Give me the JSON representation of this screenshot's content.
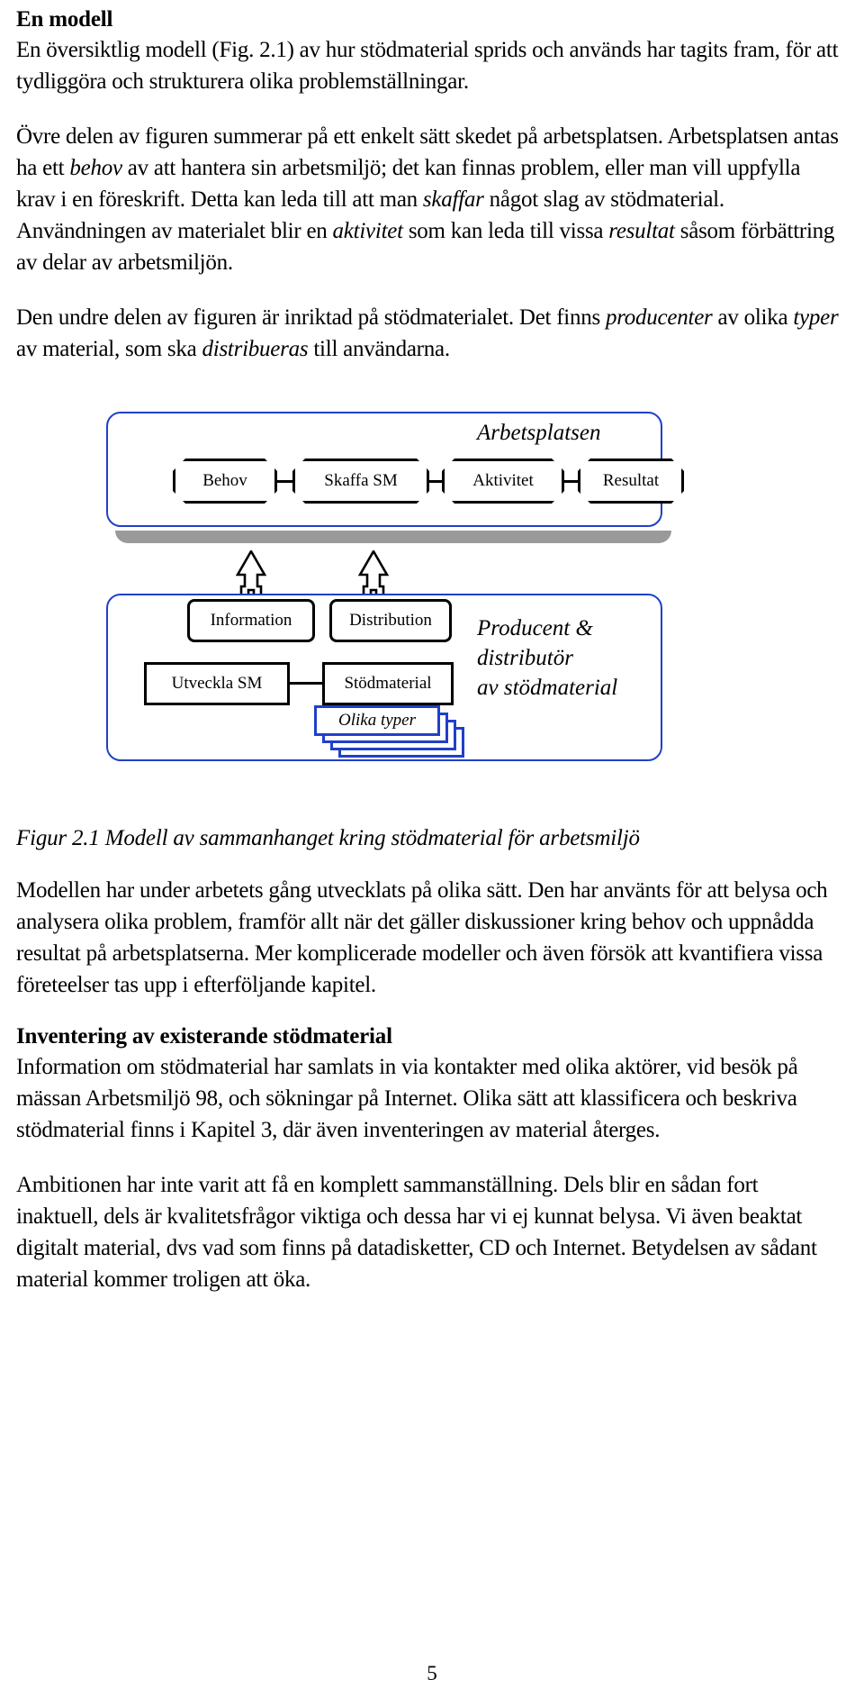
{
  "document": {
    "page_number": "5",
    "heading1": "En modell",
    "para1": {
      "runs": [
        {
          "t": "En översiktlig modell (Fig. 2.1) av hur stödmaterial sprids och används har tagits fram, för att tydliggöra och strukturera olika problemställningar.",
          "i": false
        }
      ]
    },
    "para2": {
      "runs": [
        {
          "t": "Övre delen av figuren summerar på ett enkelt sätt skedet på arbetsplatsen. Arbetsplatsen antas ha ett ",
          "i": false
        },
        {
          "t": "behov",
          "i": true
        },
        {
          "t": " av att hantera sin arbetsmiljö; det kan finnas problem, eller man vill uppfylla krav i en föreskrift. Detta kan leda till att man ",
          "i": false
        },
        {
          "t": "skaffar",
          "i": true
        },
        {
          "t": " något slag av stödmaterial. Användningen av materialet blir en ",
          "i": false
        },
        {
          "t": "aktivitet",
          "i": true
        },
        {
          "t": " som kan leda till vissa ",
          "i": false
        },
        {
          "t": "resultat",
          "i": true
        },
        {
          "t": " såsom förbättring av delar av arbetsmiljön.",
          "i": false
        }
      ]
    },
    "para3": {
      "runs": [
        {
          "t": "Den undre delen av figuren är inriktad på stödmaterialet. Det finns ",
          "i": false
        },
        {
          "t": "producenter",
          "i": true
        },
        {
          "t": " av olika ",
          "i": false
        },
        {
          "t": "typer",
          "i": true
        },
        {
          "t": " av material, som ska ",
          "i": false
        },
        {
          "t": "distribueras",
          "i": true
        },
        {
          "t": " till användarna.",
          "i": false
        }
      ]
    },
    "caption": "Figur 2.1  Modell av sammanhanget kring stödmaterial för arbetsmiljö",
    "para4": {
      "runs": [
        {
          "t": "Modellen har under arbetets gång utvecklats på olika sätt. Den har använts för att belysa och analysera olika problem, framför allt när det gäller diskussioner kring behov och uppnådda resultat på arbetsplatserna. Mer komplicerade modeller och även försök att kvantifiera vissa företeelser tas upp i efterföljande kapitel.",
          "i": false
        }
      ]
    },
    "heading2": "Inventering av existerande stödmaterial",
    "para5": {
      "runs": [
        {
          "t": "Information om stödmaterial har samlats in via kontakter med olika aktörer, vid besök på mässan Arbetsmiljö 98, och sökningar på Internet. Olika sätt att klassificera och beskriva stödmaterial finns i Kapitel 3, där även inventeringen av material återges.",
          "i": false
        }
      ]
    },
    "para6": {
      "runs": [
        {
          "t": "Ambitionen har inte varit att få en komplett sammanställning. Dels blir en sådan fort inaktuell, dels är kvalitetsfrågor viktiga och dessa har vi ej kunnat belysa. Vi även beaktat digitalt material, dvs vad som finns på datadisketter, CD och Internet. Betydelsen av sådant material kommer troligen att öka.",
          "i": false
        }
      ]
    }
  },
  "figure": {
    "colors": {
      "panel_border": "#2040c8",
      "panel_shadow": "#9a9a9a",
      "node_border": "#000000",
      "stack_border": "#2040c8"
    },
    "top_panel": {
      "label": "Arbetsplatsen",
      "nodes": [
        {
          "label": "Behov"
        },
        {
          "label": "Skaffa SM"
        },
        {
          "label": "Aktivitet"
        },
        {
          "label": "Resultat"
        }
      ]
    },
    "bottom_panel": {
      "label_lines": [
        "Producent &",
        "distributör",
        "av stödmaterial"
      ],
      "boxes": [
        {
          "label": "Information"
        },
        {
          "label": "Distribution"
        },
        {
          "label": "Utveckla SM"
        },
        {
          "label": "Stödmaterial"
        }
      ],
      "stack_label": "Olika typer"
    },
    "arrows": [
      {
        "name": "information-to-workplace"
      },
      {
        "name": "distribution-to-workplace"
      }
    ]
  }
}
